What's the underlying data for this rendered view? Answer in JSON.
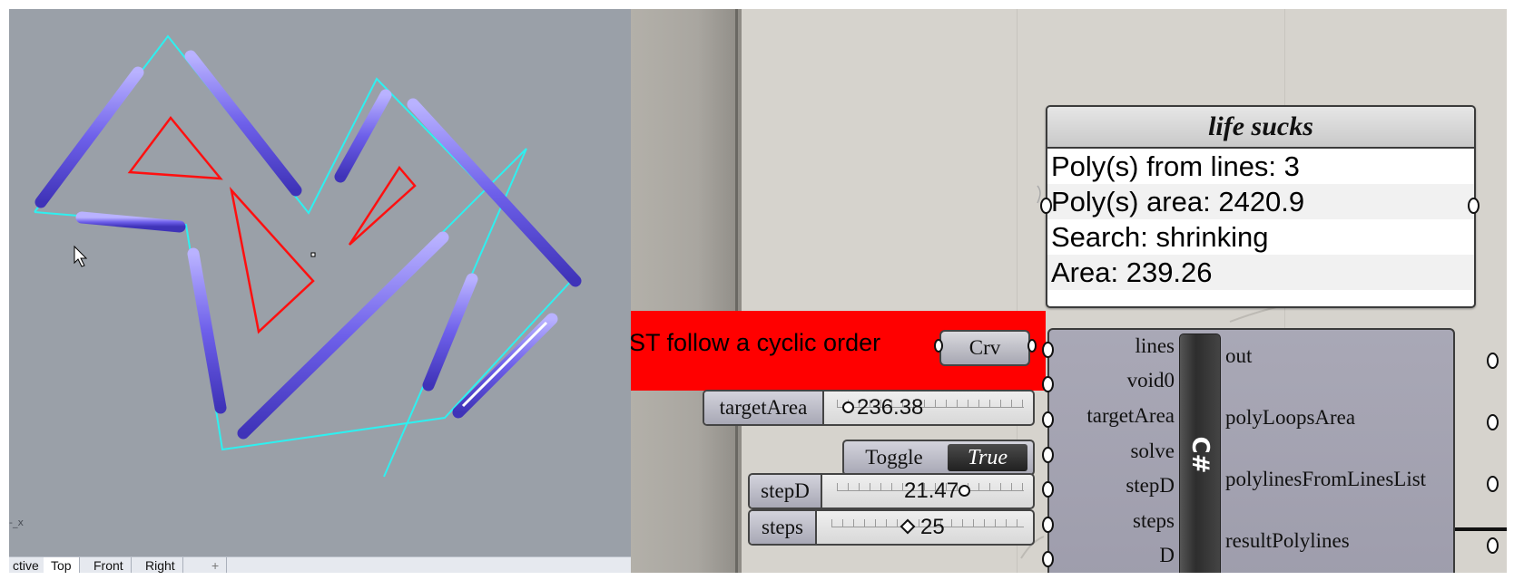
{
  "viewport": {
    "tabs": [
      "ctive",
      "Top",
      "Front",
      "Right",
      "+"
    ],
    "active_tab": "Top",
    "axis_label": "-_x",
    "colors": {
      "background": "#9aa0a8",
      "curve": "#2ef0f0",
      "pipe": "#7a6cf0",
      "triangle": "#ff1010"
    }
  },
  "panel": {
    "title": "life sucks",
    "lines": [
      "Poly(s) from lines: 3",
      "Poly(s) area: 2420.9",
      "Search: shrinking",
      "Area: 239.26"
    ]
  },
  "group": {
    "text": "ST follow a cyclic order",
    "color": "#ff0000",
    "param_label": "Crv"
  },
  "component": {
    "name": "C#",
    "inputs": [
      "lines",
      "void0",
      "targetArea",
      "solve",
      "stepD",
      "steps",
      "D"
    ],
    "outputs": [
      "out",
      "polyLoopsArea",
      "polylinesFromLinesList",
      "resultPolylines"
    ]
  },
  "sliders": {
    "targetArea": {
      "label": "targetArea",
      "value": "236.38"
    },
    "stepD": {
      "label": "stepD",
      "value": "21.47"
    },
    "steps": {
      "label": "steps",
      "value": "25"
    }
  },
  "toggle": {
    "label": "Toggle",
    "value": "True"
  }
}
